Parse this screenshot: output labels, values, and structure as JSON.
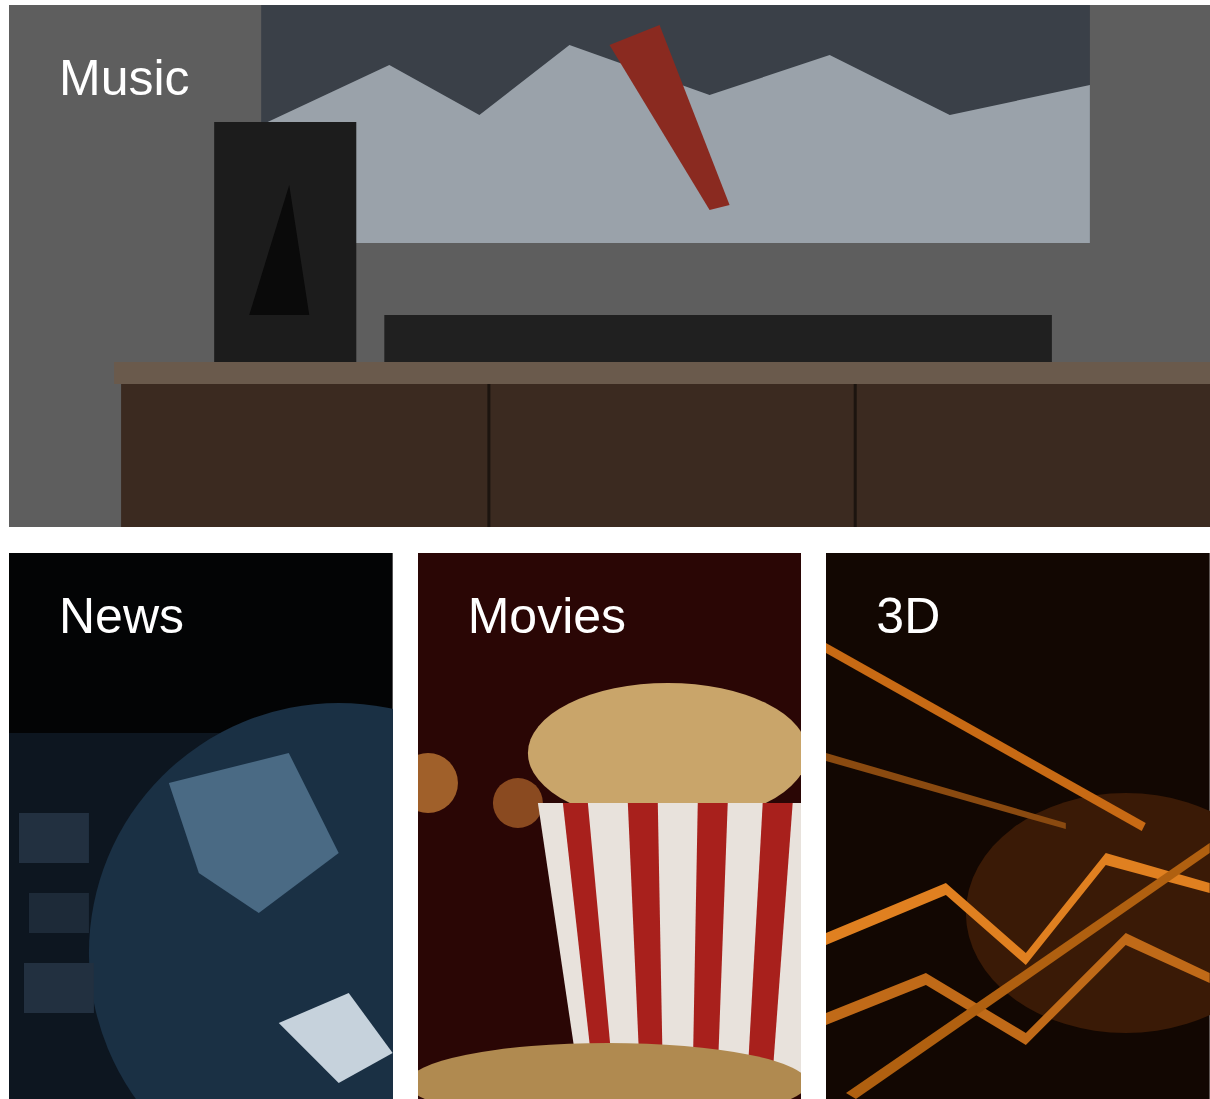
{
  "featured": {
    "title": "Music",
    "kind": "picture"
  },
  "tiles": [
    {
      "title": "News",
      "kind": "picture"
    },
    {
      "title": "Movies",
      "kind": "picture"
    },
    {
      "title": "3D",
      "kind": "picture"
    }
  ]
}
